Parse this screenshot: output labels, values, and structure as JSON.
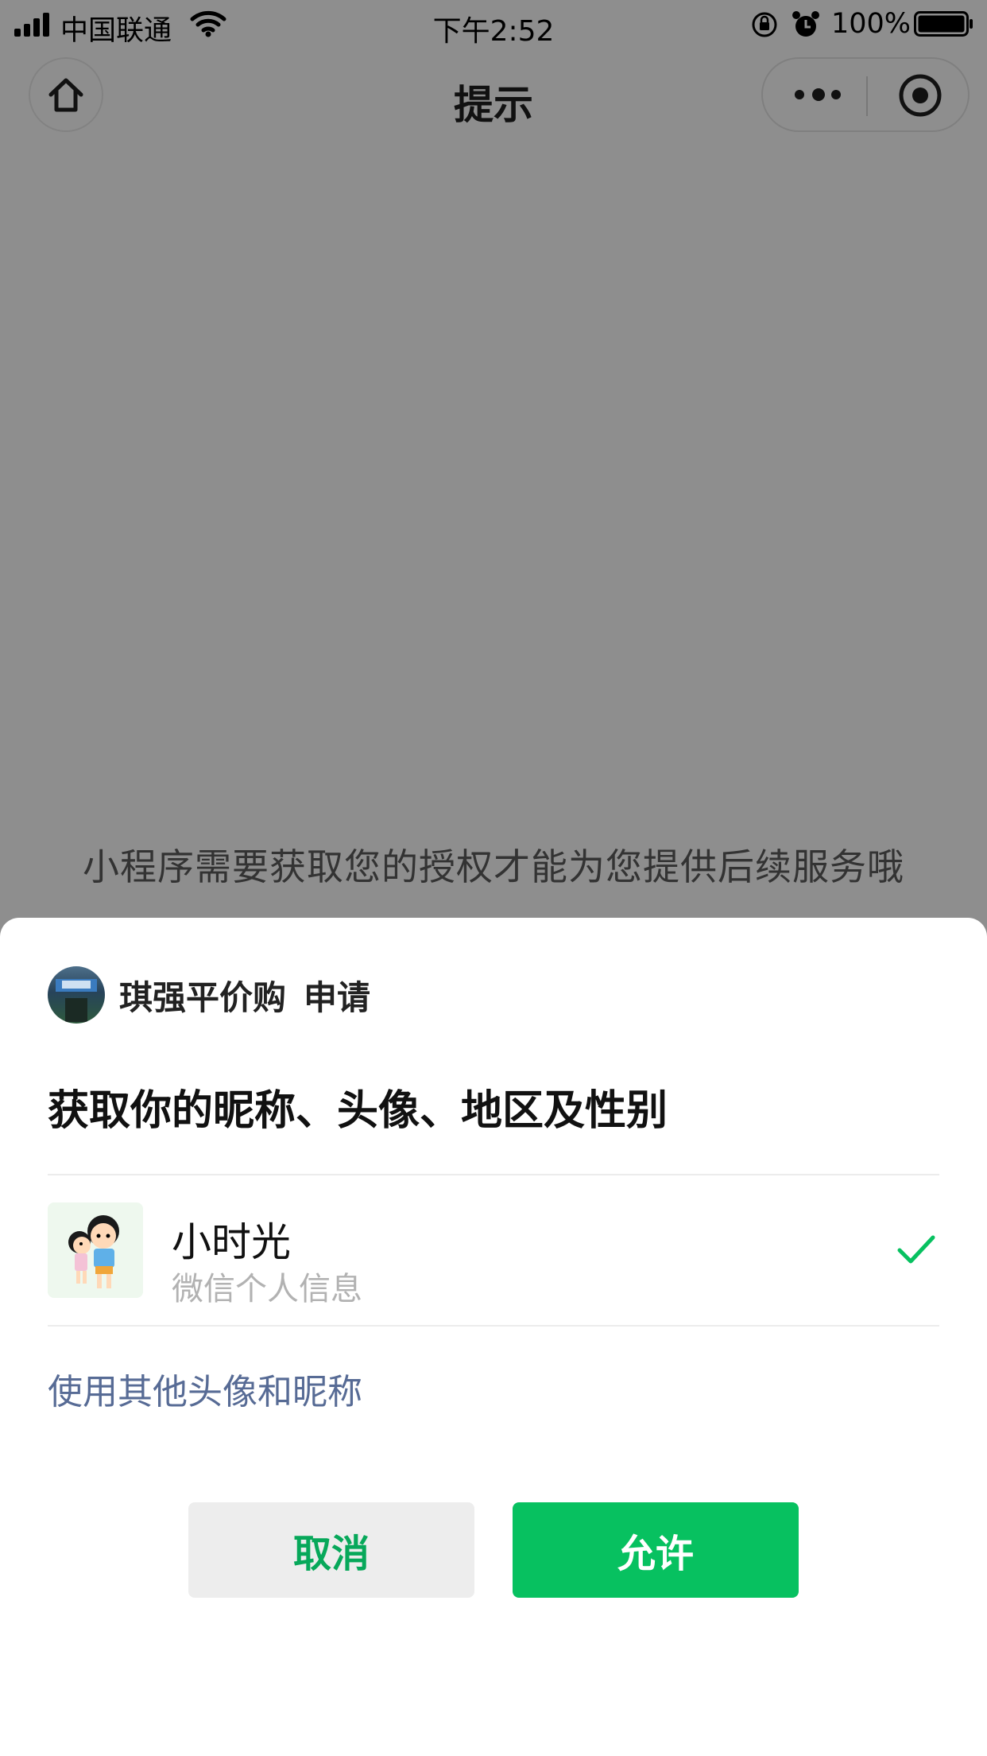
{
  "status_bar": {
    "carrier": "中国联通",
    "time": "下午2:52",
    "battery": "100%"
  },
  "nav": {
    "title": "提示",
    "icons": [
      "home-icon",
      "more-icon",
      "target-icon"
    ]
  },
  "background_message": "小程序需要获取您的授权才能为您提供后续服务哦",
  "sheet": {
    "app_name": "琪强平价购",
    "apply_label": "申请",
    "request_title": "获取你的昵称、头像、地区及性别",
    "account": {
      "name": "小时光",
      "subtitle": "微信个人信息",
      "selected": true
    },
    "other_link": "使用其他头像和昵称",
    "cancel_label": "取消",
    "allow_label": "允许"
  },
  "colors": {
    "overlay": "#8e8e8e",
    "primary_green": "#07c160",
    "link_blue": "#576b95"
  }
}
